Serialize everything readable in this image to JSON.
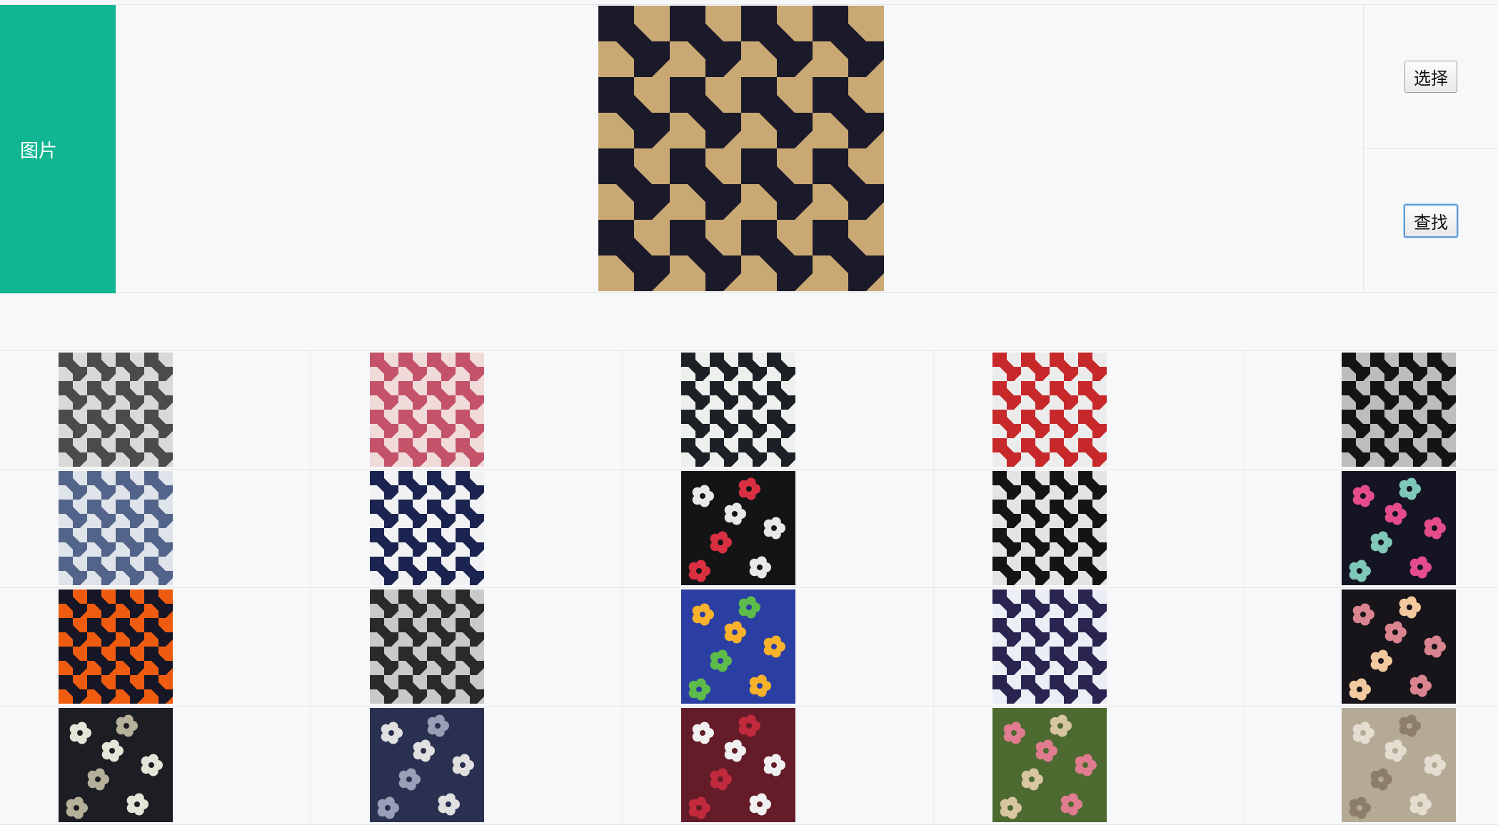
{
  "form": {
    "label": "图片",
    "select_button": "选择",
    "search_button": "查找"
  },
  "preview": {
    "icon": "houndstooth-swatch",
    "colors": [
      "#c9a873",
      "#1b1a2a"
    ]
  },
  "results": [
    [
      {
        "icon": "houndstooth-swatch",
        "colors": [
          "#d9d9d9",
          "#4b4b4b"
        ]
      },
      {
        "icon": "houndstooth-swatch",
        "colors": [
          "#f1dada",
          "#c45369"
        ]
      },
      {
        "icon": "houndstooth-swatch",
        "colors": [
          "#eef0ee",
          "#1c2126"
        ]
      },
      {
        "icon": "houndstooth-swatch",
        "colors": [
          "#ececec",
          "#c7282a"
        ]
      },
      {
        "icon": "houndstooth-swatch",
        "colors": [
          "#bdbdbd",
          "#141414"
        ]
      }
    ],
    [
      {
        "icon": "houndstooth-swatch",
        "colors": [
          "#dfe3ea",
          "#53648a"
        ]
      },
      {
        "icon": "houndstooth-swatch",
        "colors": [
          "#f2f2f4",
          "#1b2450"
        ]
      },
      {
        "icon": "floral-swatch",
        "colors": [
          "#141417",
          "#e8e8e8",
          "#d83040"
        ]
      },
      {
        "icon": "houndstooth-swatch",
        "colors": [
          "#e4e4e4",
          "#141414"
        ]
      },
      {
        "icon": "floral-swatch",
        "colors": [
          "#141422",
          "#e54c8c",
          "#7fc7b8"
        ]
      }
    ],
    [
      {
        "icon": "houndstooth-swatch",
        "colors": [
          "#ef5c10",
          "#161626"
        ]
      },
      {
        "icon": "houndstooth-swatch",
        "colors": [
          "#c9c9c9",
          "#2a2a2a"
        ]
      },
      {
        "icon": "floral-swatch",
        "colors": [
          "#2b3fa3",
          "#f7b22c",
          "#5dbb4a"
        ]
      },
      {
        "icon": "houndstooth-swatch",
        "colors": [
          "#eceef6",
          "#2a2550"
        ]
      },
      {
        "icon": "floral-swatch",
        "colors": [
          "#17141a",
          "#d9848f",
          "#f2c99e"
        ]
      }
    ],
    [
      {
        "icon": "floral-swatch",
        "colors": [
          "#1d1d24",
          "#e4e4d8",
          "#b4b09a"
        ]
      },
      {
        "icon": "floral-swatch",
        "colors": [
          "#2a3150",
          "#e0e0e0",
          "#9a9fb8"
        ]
      },
      {
        "icon": "floral-swatch",
        "colors": [
          "#641c28",
          "#f0f0f0",
          "#c02a3c"
        ]
      },
      {
        "icon": "floral-swatch",
        "colors": [
          "#4d6a30",
          "#e07c90",
          "#d8c6a0"
        ]
      },
      {
        "icon": "floral-swatch",
        "colors": [
          "#b5aa96",
          "#e4ddd0",
          "#8c7e6a"
        ]
      }
    ]
  ]
}
